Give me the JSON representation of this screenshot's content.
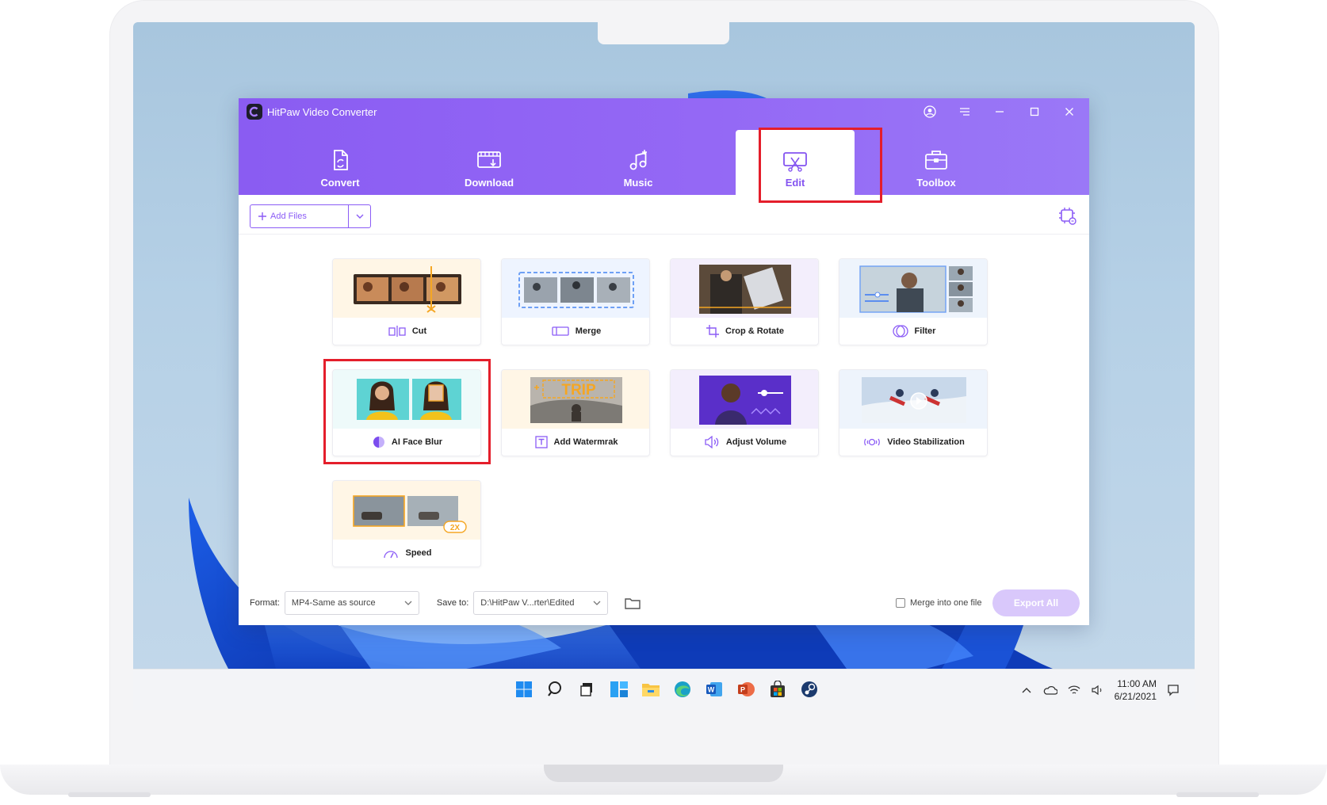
{
  "app": {
    "title": "HitPaw Video Converter",
    "accent": "#8b5cf6",
    "nav": [
      {
        "label": "Convert",
        "icon": "convert-icon"
      },
      {
        "label": "Download",
        "icon": "download-icon"
      },
      {
        "label": "Music",
        "icon": "music-icon"
      },
      {
        "label": "Edit",
        "icon": "edit-icon",
        "active": true
      },
      {
        "label": "Toolbox",
        "icon": "toolbox-icon"
      }
    ],
    "toolbar": {
      "add_files_label": "Add Files"
    },
    "tools": [
      {
        "label": "Cut",
        "icon": "cut-icon"
      },
      {
        "label": "Merge",
        "icon": "merge-icon"
      },
      {
        "label": "Crop & Rotate",
        "icon": "crop-rotate-icon"
      },
      {
        "label": "Filter",
        "icon": "filter-icon"
      },
      {
        "label": "AI Face Blur",
        "icon": "face-blur-icon",
        "highlighted": true
      },
      {
        "label": "Add Watermrak",
        "icon": "watermark-icon"
      },
      {
        "label": "Adjust Volume",
        "icon": "volume-icon"
      },
      {
        "label": "Video Stabilization",
        "icon": "stabilization-icon"
      },
      {
        "label": "Speed",
        "icon": "speed-icon"
      }
    ],
    "thumbs": {
      "watermark_text": "TRIP",
      "speed_badge": "2X"
    },
    "bottom": {
      "format_label": "Format:",
      "format_value": "MP4-Same as source",
      "save_label": "Save to:",
      "save_value": "D:\\HitPaw V...rter\\Edited",
      "merge_label": "Merge into one file",
      "merge_checked": false,
      "export_label": "Export All"
    }
  },
  "taskbar": {
    "apps": [
      "windows-start-icon",
      "search-icon",
      "task-view-icon",
      "widgets-icon",
      "file-explorer-icon",
      "edge-icon",
      "word-icon",
      "powerpoint-icon",
      "store-icon",
      "steam-icon"
    ],
    "time": "11:00 AM",
    "date": "6/21/2021"
  },
  "highlight_color": "#e41e2b"
}
